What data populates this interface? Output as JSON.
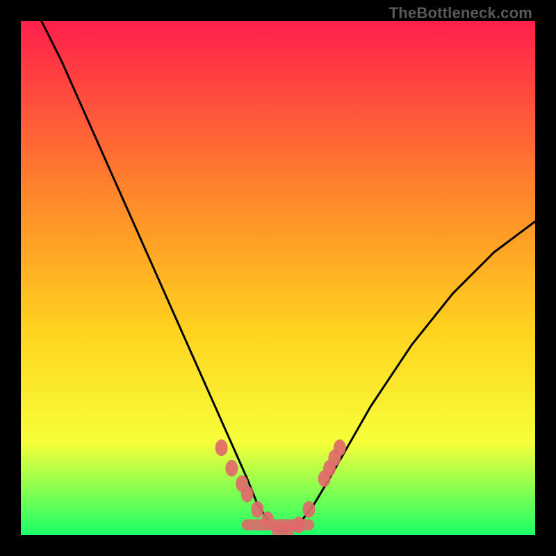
{
  "watermark": "TheBottleneck.com",
  "colors": {
    "gradient_top": "#ff1f4b",
    "gradient_mid1": "#ff8a2a",
    "gradient_mid2": "#ffd21f",
    "gradient_mid3": "#f7ff3a",
    "gradient_bottom": "#1aff66",
    "curve_stroke": "#000000",
    "marker_fill": "#e06a6a",
    "frame_bg": "#000000"
  },
  "chart_data": {
    "type": "line",
    "title": "",
    "xlabel": "",
    "ylabel": "",
    "xlim": [
      0,
      100
    ],
    "ylim": [
      0,
      100
    ],
    "grid": false,
    "legend": false,
    "series": [
      {
        "name": "curve-left",
        "x": [
          4,
          8,
          12,
          16,
          20,
          24,
          28,
          32,
          36,
          40,
          44,
          46,
          48,
          50,
          51
        ],
        "y": [
          100,
          92,
          83,
          74,
          65,
          56,
          47,
          38,
          29,
          20,
          11,
          6,
          3,
          1,
          0.5
        ]
      },
      {
        "name": "curve-right",
        "x": [
          51,
          54,
          57,
          60,
          64,
          68,
          72,
          76,
          80,
          84,
          88,
          92,
          96,
          100
        ],
        "y": [
          0.5,
          2,
          6,
          11,
          18,
          25,
          31,
          37,
          42,
          47,
          51,
          55,
          58,
          61
        ]
      }
    ],
    "highlight_points": {
      "name": "markers",
      "x": [
        39,
        41,
        43,
        44,
        46,
        48,
        50,
        52,
        54,
        56,
        59,
        60,
        61,
        62
      ],
      "y": [
        17,
        13,
        10,
        8,
        5,
        3,
        1,
        1,
        2,
        5,
        11,
        13,
        15,
        17
      ]
    },
    "valley_band": {
      "x_range": [
        44,
        56
      ],
      "y": 2
    }
  }
}
